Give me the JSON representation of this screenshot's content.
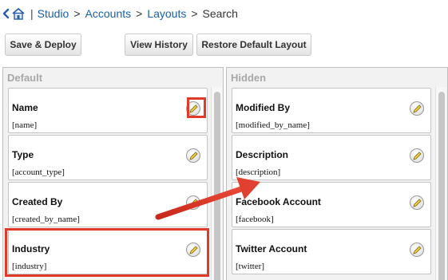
{
  "breadcrumb": {
    "separator": "|",
    "items": [
      "Studio",
      "Accounts",
      "Layouts"
    ],
    "current": "Search",
    "gt": ">"
  },
  "toolbar": {
    "save_deploy": "Save & Deploy",
    "view_history": "View History",
    "restore_default": "Restore Default Layout"
  },
  "default_panel": {
    "title": "Default",
    "fields": [
      {
        "label": "Name",
        "name": "[name]"
      },
      {
        "label": "Type",
        "name": "[account_type]"
      },
      {
        "label": "Created By",
        "name": "[created_by_name]"
      },
      {
        "label": "Industry",
        "name": "[industry]"
      }
    ]
  },
  "hidden_panel": {
    "title": "Hidden",
    "fields": [
      {
        "label": "Modified By",
        "name": "[modified_by_name]"
      },
      {
        "label": "Description",
        "name": "[description]"
      },
      {
        "label": "Facebook Account",
        "name": "[facebook]"
      },
      {
        "label": "Twitter Account",
        "name": "[twitter]"
      }
    ]
  },
  "icons": {
    "back": "back-arrow-icon",
    "home": "home-icon",
    "edit": "pencil-edit-icon"
  },
  "colors": {
    "link": "#1a5fa8",
    "annotation": "#e03a2a",
    "panel_bg": "#f2f2f2",
    "panel_title": "#a8a8a8"
  }
}
